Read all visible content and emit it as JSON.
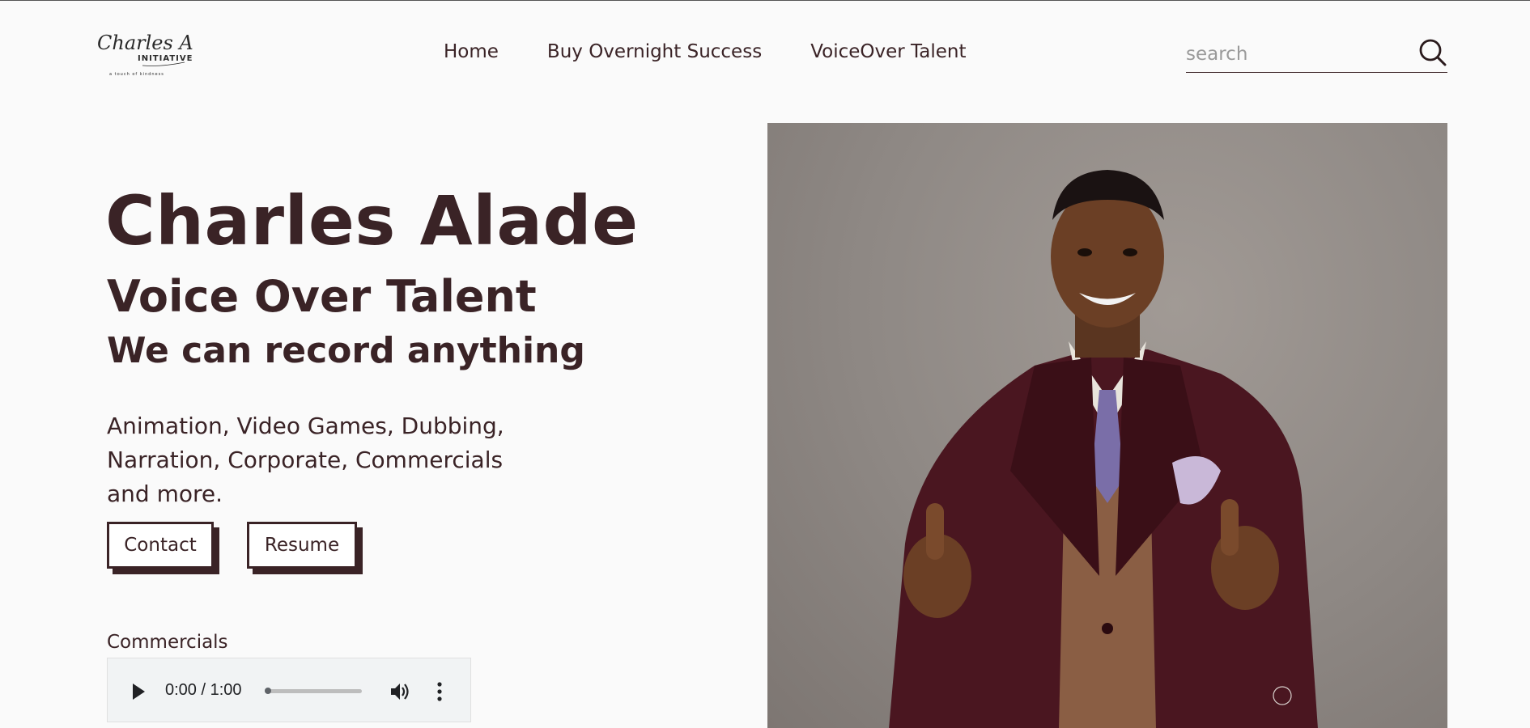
{
  "header": {
    "logo": {
      "script_text": "Charles Alade",
      "bold_text": "INITIATIVE",
      "small_text": "a touch of kindness"
    },
    "nav": [
      {
        "label": "Home"
      },
      {
        "label": "Buy Overnight Success"
      },
      {
        "label": "VoiceOver Talent"
      }
    ],
    "search": {
      "placeholder": "search",
      "icon": "search-icon"
    }
  },
  "hero": {
    "name": "Charles Alade",
    "subtitle": "Voice Over Talent",
    "tagline": "We can record anything",
    "description": "Animation, Video Games, Dubbing, Narration, Corporate, Commercials and more.",
    "buttons": {
      "contact": "Contact",
      "resume": "Resume"
    }
  },
  "audio": {
    "label": "Commercials",
    "time": "0:00 / 1:00",
    "progress_fraction": 0,
    "icons": [
      "play-icon",
      "volume-icon",
      "more-options-icon"
    ]
  },
  "colors": {
    "text": "#3a2326",
    "background": "#fafafa",
    "button_shadow": "#3a2326"
  }
}
